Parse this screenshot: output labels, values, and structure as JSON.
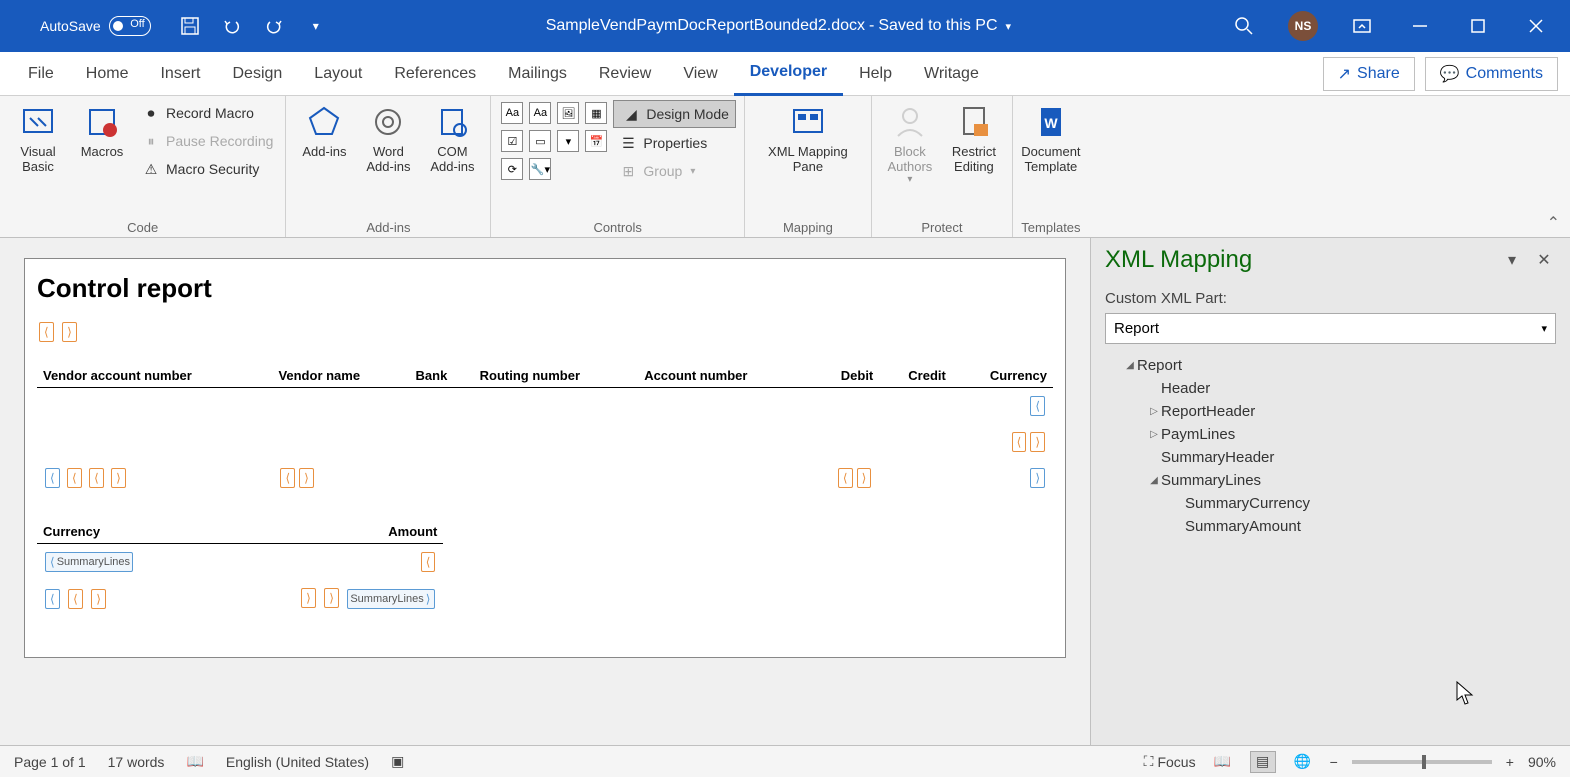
{
  "titlebar": {
    "autosave_label": "AutoSave",
    "doc_name": "SampleVendPaymDocReportBounded2.docx",
    "save_status": "Saved to this PC",
    "avatar": "NS"
  },
  "tabs": {
    "file": "File",
    "home": "Home",
    "insert": "Insert",
    "design": "Design",
    "layout": "Layout",
    "references": "References",
    "mailings": "Mailings",
    "review": "Review",
    "view": "View",
    "developer": "Developer",
    "help": "Help",
    "writage": "Writage",
    "share": "Share",
    "comments": "Comments"
  },
  "ribbon": {
    "code": {
      "visual_basic": "Visual Basic",
      "macros": "Macros",
      "record": "Record Macro",
      "pause": "Pause Recording",
      "security": "Macro Security",
      "group": "Code"
    },
    "addins": {
      "addins": "Add-ins",
      "word": "Word Add-ins",
      "com": "COM Add-ins",
      "group": "Add-ins"
    },
    "controls": {
      "design_mode": "Design Mode",
      "properties": "Properties",
      "group_btn": "Group",
      "group": "Controls"
    },
    "mapping": {
      "xml_pane": "XML Mapping Pane",
      "group": "Mapping"
    },
    "protect": {
      "block": "Block Authors",
      "restrict": "Restrict Editing",
      "group": "Protect"
    },
    "templates": {
      "doc_template": "Document Template",
      "group": "Templates"
    }
  },
  "document": {
    "title": "Control report",
    "headers": {
      "vendor_acct": "Vendor account number",
      "vendor_name": "Vendor name",
      "bank": "Bank",
      "routing": "Routing number",
      "account": "Account number",
      "debit": "Debit",
      "credit": "Credit",
      "currency": "Currency"
    },
    "summary_headers": {
      "currency": "Currency",
      "amount": "Amount"
    },
    "cc_labels": {
      "summary_lines": "SummaryLines"
    }
  },
  "pane": {
    "title": "XML Mapping",
    "label": "Custom XML Part:",
    "selected": "Report",
    "tree": {
      "root": "Report",
      "header": "Header",
      "report_header": "ReportHeader",
      "paym_lines": "PaymLines",
      "summary_header": "SummaryHeader",
      "summary_lines": "SummaryLines",
      "summary_currency": "SummaryCurrency",
      "summary_amount": "SummaryAmount"
    }
  },
  "statusbar": {
    "page": "Page 1 of 1",
    "words": "17 words",
    "lang": "English (United States)",
    "focus": "Focus",
    "zoom": "90%"
  }
}
